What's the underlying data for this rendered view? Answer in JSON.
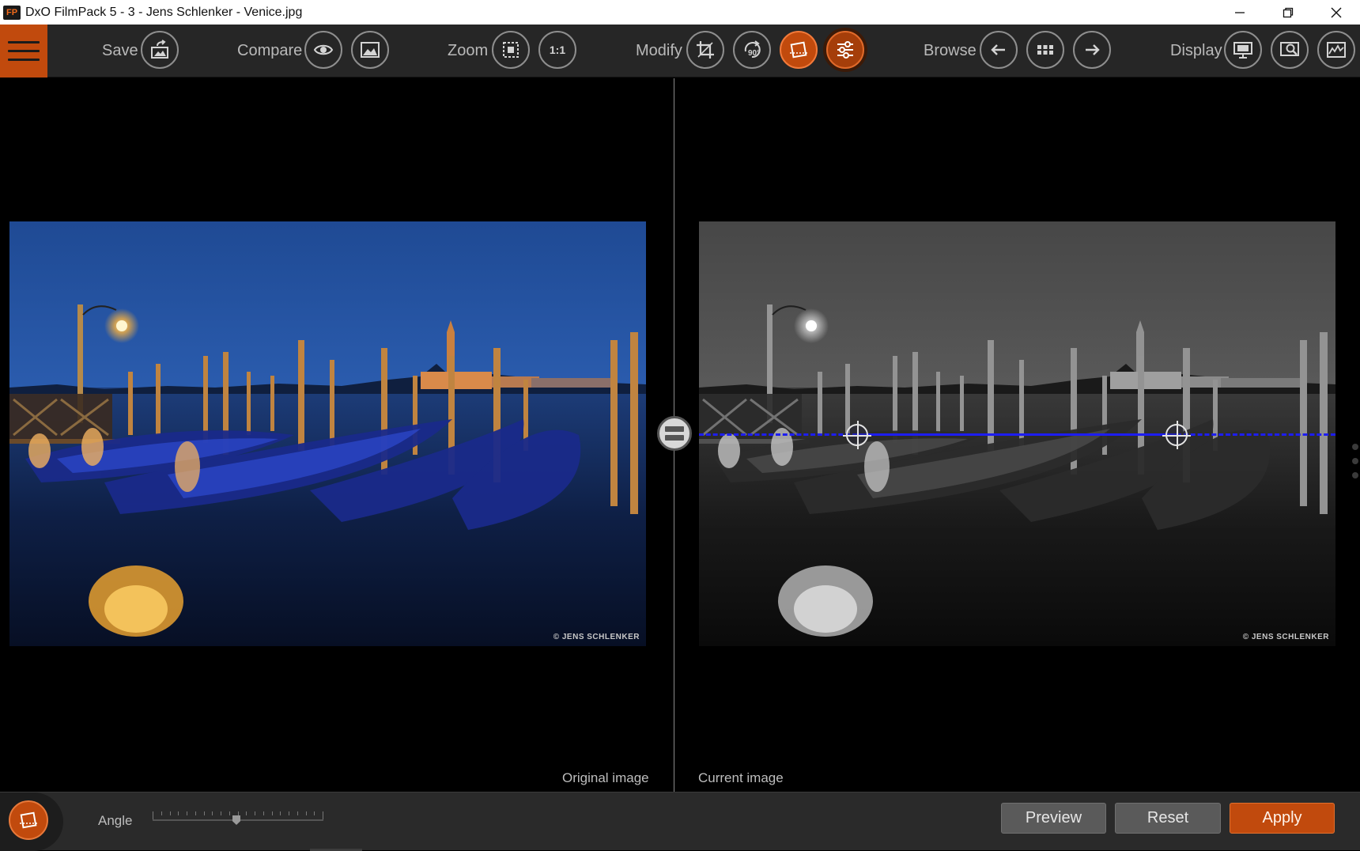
{
  "window": {
    "app_icon": "FP",
    "title": "DxO FilmPack 5 - 3 - Jens Schlenker - Venice.jpg",
    "controls": [
      "minimize",
      "restore",
      "close"
    ]
  },
  "toolbar": {
    "menu_icon": "hamburger-icon",
    "save_label": "Save",
    "compare_label": "Compare",
    "zoom_label": "Zoom",
    "zoom_11": "1:1",
    "modify_label": "Modify",
    "rotate_90": "90°",
    "browse_label": "Browse",
    "display_label": "Display"
  },
  "viewer": {
    "original_label": "Original image",
    "current_label": "Current image",
    "credit": "© JENS SCHLENKER"
  },
  "bottom": {
    "angle_label": "Angle",
    "angle_value": 0,
    "preview_label": "Preview",
    "reset_label": "Reset",
    "apply_label": "Apply"
  },
  "colors": {
    "accent": "#c14a0d",
    "toolbar_bg": "#262626",
    "horizon_line": "#1d1df2"
  }
}
